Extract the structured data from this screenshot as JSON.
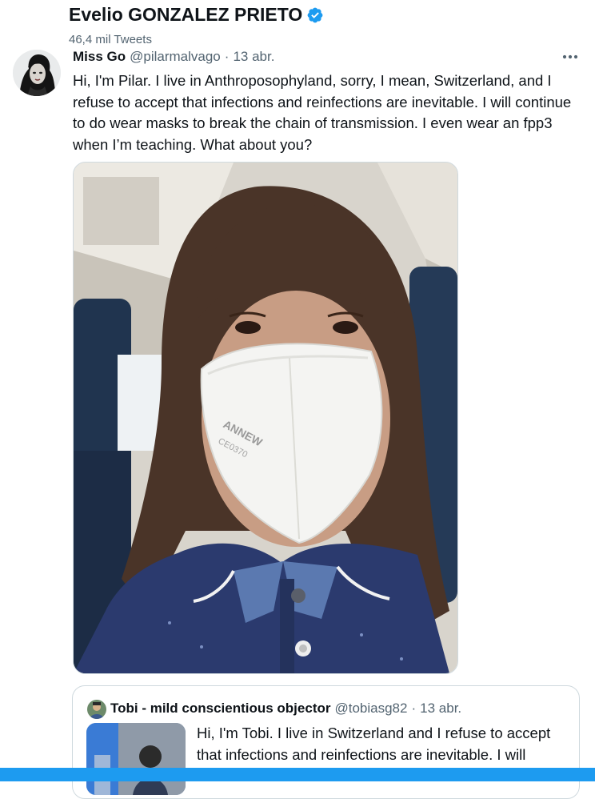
{
  "header": {
    "title": "Evelio GONZALEZ PRIETO",
    "tweet_count": "46,4 mil Tweets"
  },
  "tweet": {
    "author_name": "Miss Go",
    "handle": "@pilarmalvago",
    "separator": "·",
    "date": "13 abr.",
    "text": "Hi, I'm Pilar. I live in Anthroposophyland, sorry, I mean, Switzerland, and I refuse to accept that infections and reinfections are inevitable. I will continue to do wear masks to break the chain of transmission. I even wear an fpp3 when I’m teaching. What about you?",
    "mask_print": [
      "ANNEW",
      "CE0370"
    ]
  },
  "quote": {
    "author_name": "Tobi - mild conscientious objector",
    "handle": "@tobiasg82",
    "separator": "·",
    "date": "13 abr.",
    "text": "Hi, I'm Tobi. I live in Switzerland and I refuse to accept that infections and reinfections are inevitable. I will continue to wear masks to break the chain of"
  },
  "colors": {
    "accent": "#1d9bf0",
    "text_secondary": "#536471",
    "border": "#cfd9de"
  }
}
